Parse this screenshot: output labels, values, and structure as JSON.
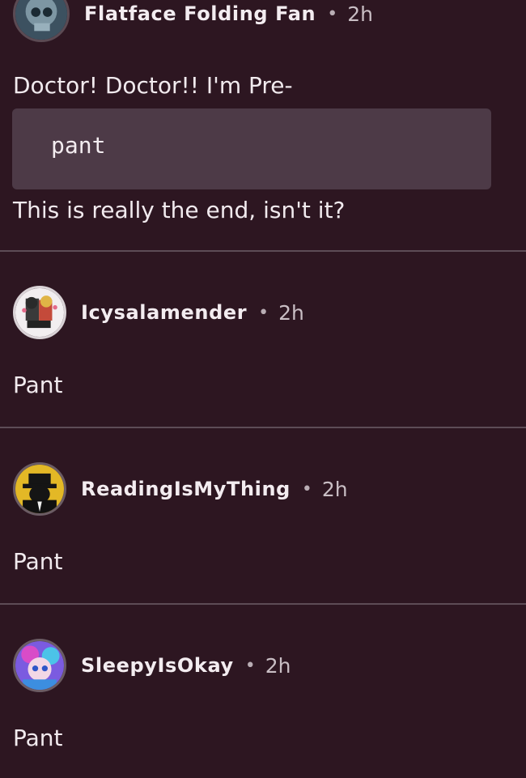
{
  "comments": [
    {
      "username": "Flatface Folding Fan",
      "separator": "•",
      "time": "2h",
      "text_before": "Doctor! Doctor!! I'm Pre-",
      "code": "pant",
      "text_after": "This is really the end, isn't it?"
    },
    {
      "username": "Icysalamender",
      "separator": "•",
      "time": "2h",
      "text": "Pant"
    },
    {
      "username": "ReadingIsMyThing",
      "separator": "•",
      "time": "2h",
      "text": "Pant"
    },
    {
      "username": "SleepyIsOkay",
      "separator": "•",
      "time": "2h",
      "text": "Pant"
    }
  ],
  "colors": {
    "background": "#2d1621",
    "code_block": "#4d3a47",
    "divider": "#5d4c56",
    "text": "#f1eaee"
  }
}
